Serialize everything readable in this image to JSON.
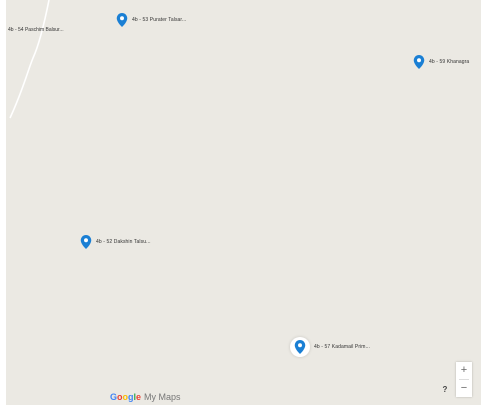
{
  "map": {
    "edge_label": "4b - 54 Paschim Balsur...",
    "markers": [
      {
        "label": "4b - 53 Purater Talsar...",
        "selected": false
      },
      {
        "label": "4b - 59 Khanagra",
        "selected": false
      },
      {
        "label": "4b - 52 Dakshin Talsu...",
        "selected": false
      },
      {
        "label": "4b - 57 Kadamail Prim...",
        "selected": true
      }
    ],
    "marker_color": "#1a7fd4"
  },
  "branding": {
    "logo": "Google",
    "product": "My Maps"
  },
  "controls": {
    "help": "?",
    "zoom_in": "+",
    "zoom_out": "−"
  }
}
